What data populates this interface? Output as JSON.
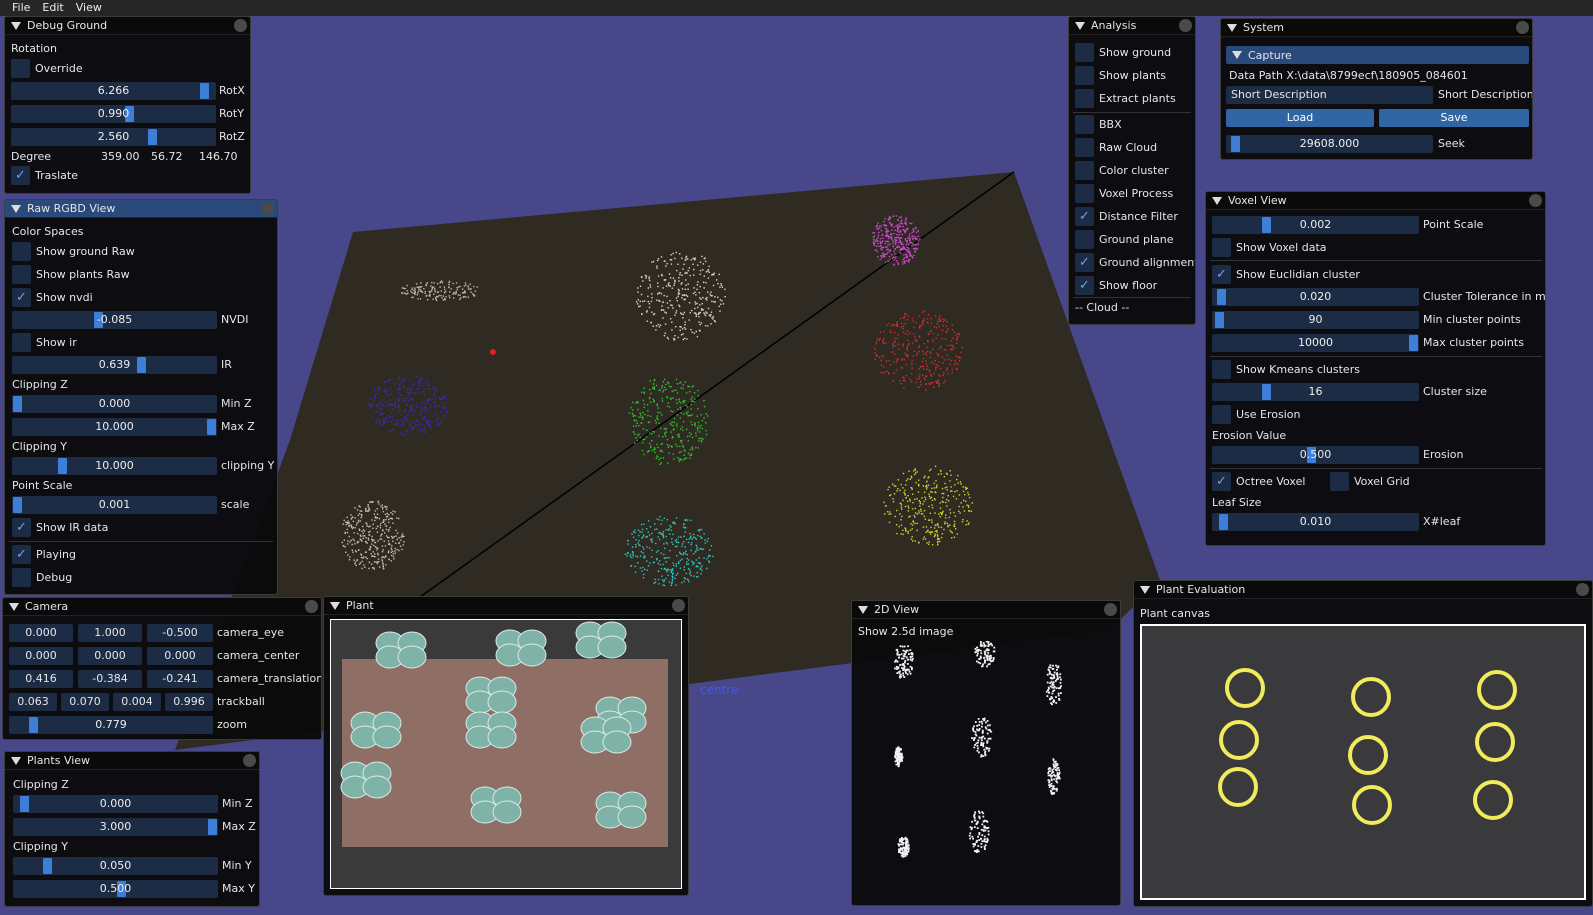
{
  "menubar": {
    "file": "File",
    "edit": "Edit",
    "view": "View"
  },
  "scene": {
    "label_centre": "centre"
  },
  "debug_ground": {
    "title": "Debug Ground",
    "rotation": "Rotation",
    "override": "Override",
    "rotx": {
      "value": "6.266",
      "label": "RotX",
      "fill": 0.97
    },
    "roty": {
      "value": "0.990",
      "label": "RotY",
      "fill": 0.58
    },
    "rotz": {
      "value": "2.560",
      "label": "RotZ",
      "fill": 0.7
    },
    "degree": "Degree",
    "deg_x": "359.00",
    "deg_y": "56.72",
    "deg_z": "146.70",
    "traslate": "Traslate"
  },
  "raw_rgbd": {
    "title": "Raw RGBD View",
    "color_spaces": "Color Spaces",
    "show_ground_raw": "Show ground Raw",
    "show_plants_raw": "Show plants Raw",
    "show_nvdi": "Show nvdi",
    "nvdi": {
      "value": "-0.085",
      "label": "NVDI",
      "fill": 0.42
    },
    "show_ir": "Show ir",
    "ir": {
      "value": "0.639",
      "label": "IR",
      "fill": 0.64
    },
    "clipping_z": "Clipping Z",
    "min_z": {
      "value": "0.000",
      "label": "Min Z",
      "fill": 0
    },
    "max_z": {
      "value": "10.000",
      "label": "Max Z",
      "fill": 1
    },
    "clipping_y": "Clipping Y",
    "clip_y": {
      "value": "10.000",
      "label": "clipping Y",
      "fill": 0.23
    },
    "point_scale": "Point Scale",
    "scale": {
      "value": "0.001",
      "label": "scale",
      "fill": 0
    },
    "show_ir_data": "Show IR data",
    "playing": "Playing",
    "debug": "Debug"
  },
  "camera": {
    "title": "Camera",
    "eye": [
      "0.000",
      "1.000",
      "-0.500"
    ],
    "eye_label": "camera_eye",
    "center": [
      "0.000",
      "0.000",
      "0.000"
    ],
    "center_label": "camera_center",
    "translation": [
      "0.416",
      "-0.384",
      "-0.241"
    ],
    "translation_label": "camera_translation",
    "trackball": [
      "0.063",
      "0.070",
      "0.004",
      "0.996"
    ],
    "trackball_label": "trackball",
    "zoom": {
      "value": "0.779",
      "label": "zoom",
      "fill": 0.1
    }
  },
  "plants_view": {
    "title": "Plants View",
    "clipping_z": "Clipping Z",
    "min_z": {
      "value": "0.000",
      "label": "Min Z",
      "fill": 0.03
    },
    "max_z": {
      "value": "3.000",
      "label": "Max Z",
      "fill": 1
    },
    "clipping_y": "Clipping Y",
    "min_y": {
      "value": "0.050",
      "label": "Min Y",
      "fill": 0.15
    },
    "max_y": {
      "value": "0.500",
      "label": "Max Y",
      "fill": 0.53
    }
  },
  "plant": {
    "title": "Plant"
  },
  "analysis": {
    "title": "Analysis",
    "items": [
      "Show ground",
      "Show plants",
      "Extract plants"
    ],
    "items2": [
      "BBX",
      "Raw Cloud",
      "Color cluster",
      "Voxel Process",
      "Distance Filter",
      "Ground plane",
      "Ground alignment",
      "Show floor"
    ],
    "checked2": [
      false,
      false,
      false,
      false,
      true,
      false,
      true,
      true
    ],
    "cloud": "-- Cloud --"
  },
  "system": {
    "title": "System",
    "capture": "Capture",
    "data_path": "Data Path X:\\data\\8799ecf\\180905_084601",
    "short_desc_value": "Short Description",
    "short_desc_label": "Short Description",
    "load": "Load",
    "save": "Save",
    "seek": {
      "value": "29608.000",
      "label": "Seek",
      "fill": 0.02
    }
  },
  "voxel": {
    "title": "Voxel View",
    "point_scale": {
      "value": "0.002",
      "label": "Point Scale",
      "fill": 0.25
    },
    "show_voxel_data": "Show Voxel data",
    "show_euclidian": "Show Euclidian cluster",
    "cluster_tol": {
      "value": "0.020",
      "label": "Cluster Tolerance in m",
      "fill": 0.02
    },
    "min_cluster": {
      "value": "90",
      "label": "Min cluster points",
      "fill": 0.01
    },
    "max_cluster": {
      "value": "10000",
      "label": "Max cluster points",
      "fill": 1
    },
    "show_kmeans": "Show Kmeans clusters",
    "cluster_size": {
      "value": "16",
      "label": "Cluster size",
      "fill": 0.25
    },
    "use_erosion": "Use Erosion",
    "erosion_value": "Erosion Value",
    "erosion": {
      "value": "0.500",
      "label": "Erosion",
      "fill": 0.48
    },
    "octree": "Octree Voxel",
    "voxel_grid": "Voxel Grid",
    "leaf_size": "Leaf Size",
    "leaf": {
      "value": "0.010",
      "label": "X#leaf",
      "fill": 0.03
    }
  },
  "view2d": {
    "title": "2D View",
    "show": "Show 2.5d image"
  },
  "plant_eval": {
    "title": "Plant Evaluation",
    "canvas": "Plant canvas"
  }
}
